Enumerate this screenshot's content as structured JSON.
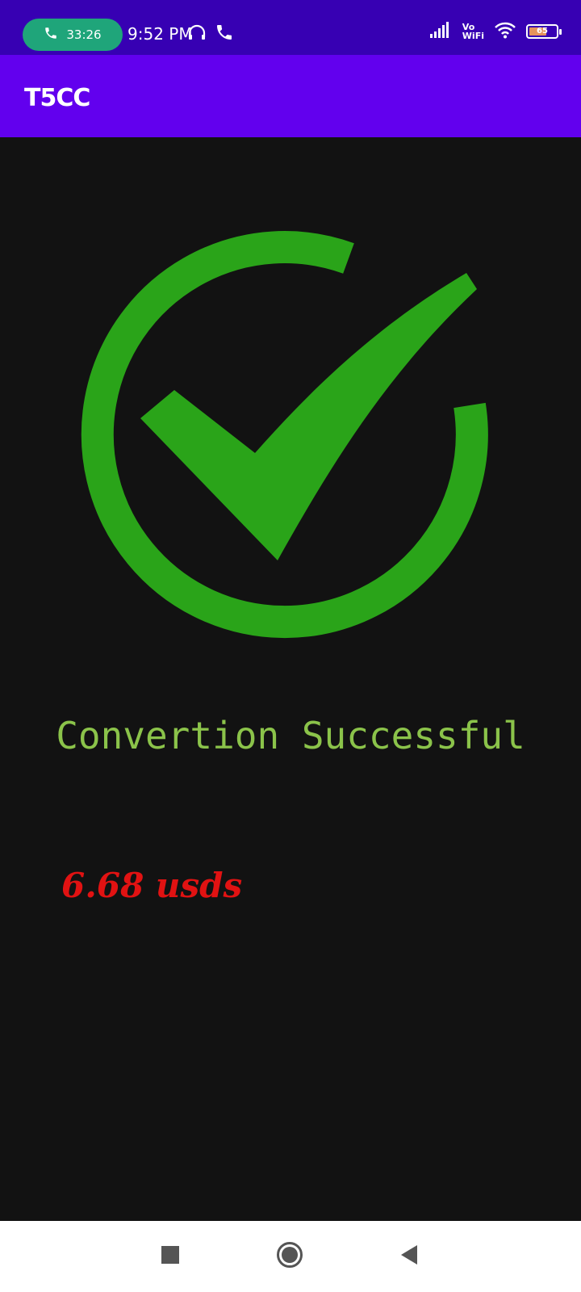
{
  "status_bar": {
    "call_timer": "33:26",
    "time": "9:52 PM",
    "network_label_top": "Vo",
    "network_label_bottom": "WiFi",
    "battery_level": "65",
    "battery_fraction": 0.65,
    "colors": {
      "background": "#3700b3",
      "call_pill": "#1fa57a"
    },
    "icons": [
      "phone-icon",
      "headphones-icon",
      "phone-call-icon",
      "signal-icon",
      "wifi-icon",
      "battery-icon"
    ]
  },
  "app_bar": {
    "title": "T5CC",
    "color": "#6200ee"
  },
  "main": {
    "status_icon": "check-circle-icon",
    "icon_color": "#2aa419",
    "message": "Convertion Successful",
    "message_color": "#8bc34a",
    "amount": "6.68 usds",
    "amount_color": "#e11212"
  },
  "nav_bar": {
    "icons": [
      "recents-square-icon",
      "home-circle-icon",
      "back-triangle-icon"
    ]
  }
}
